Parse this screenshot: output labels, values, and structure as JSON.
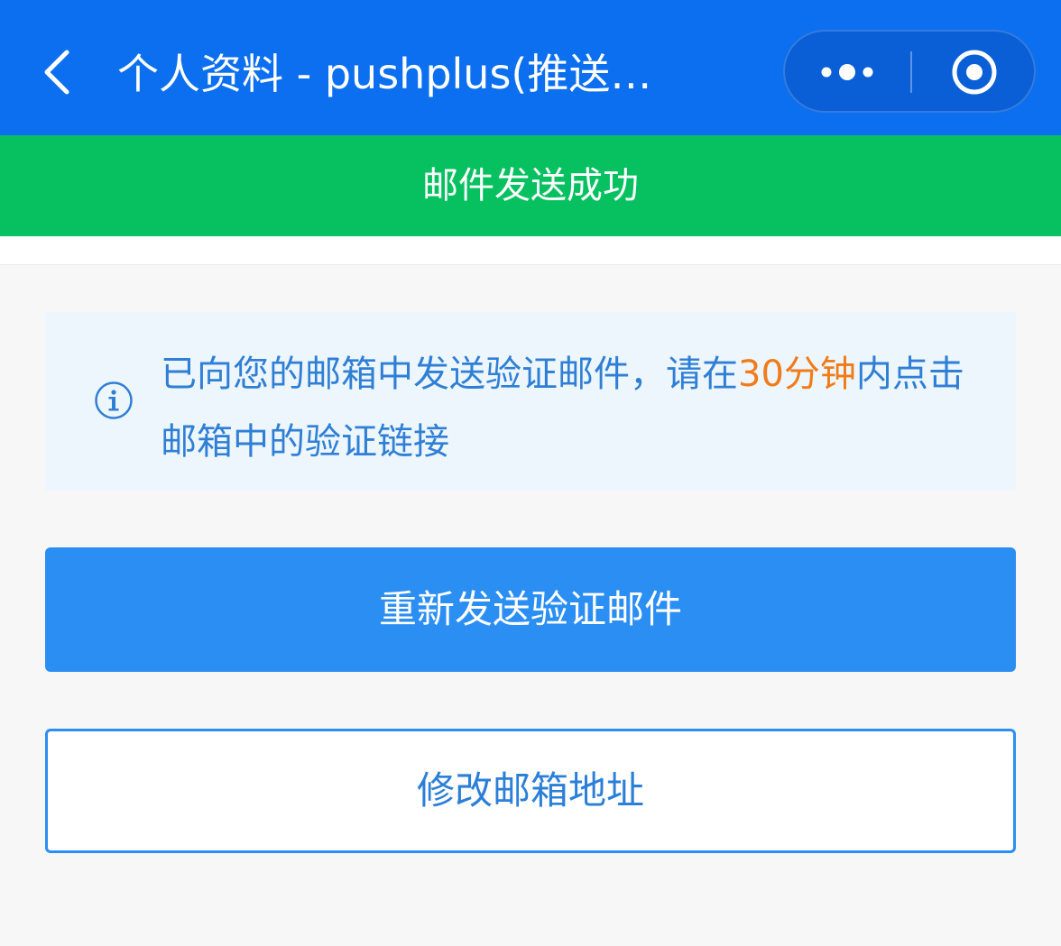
{
  "navbar": {
    "title": "个人资料 - pushplus(推送…",
    "back_icon": "chevron-left-icon",
    "more_icon": "more-dots-icon",
    "close_icon": "target-circle-icon",
    "background": "#0b6ff0"
  },
  "toast": {
    "message": "邮件发送成功",
    "background": "#07c160"
  },
  "notice": {
    "icon": "info-icon",
    "text_before": "已向您的邮箱中发送验证邮件，请在",
    "highlight": "30分钟",
    "text_after": "内点击邮箱中的验证链接",
    "text_color": "#2f7fd6",
    "highlight_color": "#f07b1a"
  },
  "actions": {
    "resend_label": "重新发送验证邮件",
    "change_email_label": "修改邮箱地址",
    "accent": "#2b8ef3"
  }
}
